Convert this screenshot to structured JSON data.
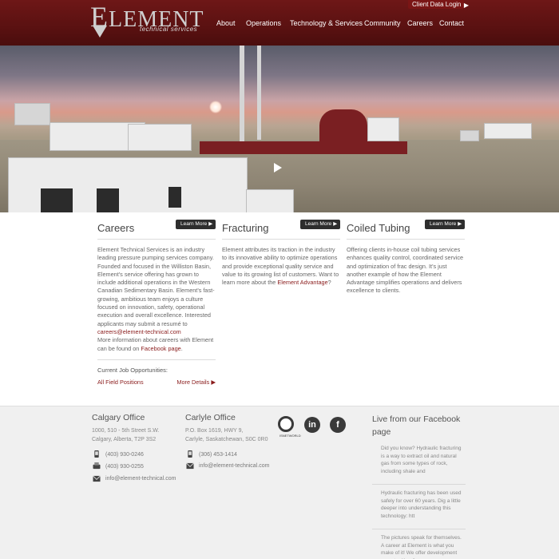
{
  "header": {
    "client_login": "Client Data Login",
    "logo": {
      "word_initial": "E",
      "word_rest": "LEMENT",
      "tagline": "technical services"
    },
    "nav": [
      "About",
      "Operations",
      "Technology & Services",
      "Community",
      "Careers",
      "Contact"
    ]
  },
  "columns": [
    {
      "title": "Careers",
      "learn_more": "Learn More",
      "text_parts": [
        "Element Technical Services is an industry leading pressure pumping services company. Founded and focused in the Williston Basin, Element's service offering has grown to include additional operations in the Western Canadian Sedimentary Basin. Element's fast-growing, ambitious team enjoys a culture focused on innovation, safety, operational execution and overall excellence. Interested applicants may submit a resumé to ",
        "careers@element-technical.com",
        "More information about careers with Element can be found on ",
        "Facebook page",
        "."
      ],
      "jobs_title": "Current Job Opportunities:",
      "jobs": [
        {
          "name": "All Field Positions",
          "details": "More Details"
        }
      ]
    },
    {
      "title": "Fracturing",
      "learn_more": "Learn More",
      "text_parts": [
        "Element attributes its traction in the industry to its innovative ability to optimize operations and provide exceptional quality service and value to its growing list of customers. Want to learn more about the ",
        "Element Advantage",
        "?"
      ]
    },
    {
      "title": "Coiled Tubing",
      "learn_more": "Learn More",
      "text": "Offering clients in-house coil tubing services enhances quality control, coordinated service and optimization of frac design. It's just another example of how the Element Advantage simplifies operations and delivers excellence to clients."
    }
  ],
  "footer": {
    "calgary": {
      "title": "Calgary Office",
      "addr1": "1000, 510 - 5th Street S.W.",
      "addr2": "Calgary, Alberta, T2P 3S2",
      "phone": "(403) 930-0246",
      "fax": "(403) 930-0255",
      "email": "info@element-technical.com"
    },
    "carlyle": {
      "title": "Carlyle Office",
      "addr1": "P.O. Box 1619, HWY 9,",
      "addr2": "Carlyle, Saskatchewan, S0C 0R0",
      "phone": "(306) 453-1414",
      "email": "info@element-technical.com"
    },
    "badge_label": "ISNETWORLD",
    "social": [
      {
        "icon": "linkedin-icon",
        "glyph": "in"
      },
      {
        "icon": "facebook-icon",
        "glyph": "f"
      }
    ],
    "facebook": {
      "title": "Live from our Facebook page",
      "posts": [
        "Did you know? Hydraulic fracturing is a way to extract oil and natural gas from some types of rock, including shale and",
        "Hydraulic fracturing has been used safely for over 60 years. Dig a little deeper into understanding this technology: htt",
        "The pictures speak for themselves. A career at Element is what you make of it! We offer development opportunities &"
      ]
    }
  },
  "colors": {
    "brand": "#6e1717",
    "link": "#8a1c1c",
    "button": "#2e2e2e"
  }
}
